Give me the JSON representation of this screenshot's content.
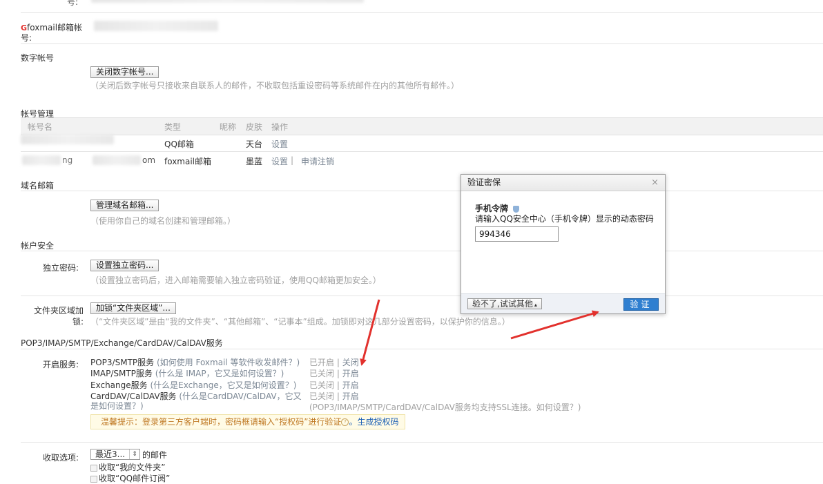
{
  "accounts_top": {
    "top_label_fragment": "号:",
    "foxmail_label": "foxmail邮箱帐号:",
    "foxmail_icon": "foxmail-logo-icon"
  },
  "digital_account": {
    "title": "数字帐号",
    "button": "关闭数字帐号...",
    "note": "（关闭后数字帐号只接收来自联系人的邮件，不收取包括重设密码等系统邮件在内的其他所有邮件。）"
  },
  "account_management": {
    "title": "帐号管理",
    "headers": [
      "帐号名",
      "类型",
      "昵称",
      "皮肤",
      "操作"
    ],
    "rows": [
      {
        "type": "QQ邮箱",
        "skin": "天台",
        "actions": [
          "设置"
        ]
      },
      {
        "name_fragment_a": "ng",
        "name_fragment_b": "om",
        "type": "foxmail邮箱",
        "skin": "墨蓝",
        "actions": [
          "设置",
          "申请注销"
        ],
        "separator": "|"
      }
    ]
  },
  "domain_mail": {
    "title": "域名邮箱",
    "button": "管理域名邮箱...",
    "note": "（使用你自己的域名创建和管理邮箱。）"
  },
  "security": {
    "title": "帐户安全",
    "independent_label": "独立密码:",
    "independent_button": "设置独立密码...",
    "independent_note": "（设置独立密码后，进入邮箱需要输入独立密码验证，使用QQ邮箱更加安全。）",
    "folder_label_1": "文件夹区域加",
    "folder_label_2": "锁:",
    "folder_button": "加锁“文件夹区域”...",
    "folder_note": "（“文件夹区域”是由“我的文件夹”、“其他邮箱”、“记事本”组成。加锁即对这几部分设置密码，以保护你的信息。）"
  },
  "pop3": {
    "title": "POP3/IMAP/SMTP/Exchange/CardDAV/CalDAV服务",
    "label": "开启服务:",
    "services": [
      {
        "name": "POP3/SMTP服务",
        "help": "(如何使用 Foxmail 等软件收发邮件？)",
        "status": "已开启",
        "sep": "|",
        "action": "关闭"
      },
      {
        "name": "IMAP/SMTP服务",
        "help": "(什么是 IMAP，它又是如何设置？)",
        "status": "已关闭",
        "sep": "|",
        "action": "开启"
      },
      {
        "name": "Exchange服务",
        "help": "(什么是Exchange，它又是如何设置？)",
        "status": "已关闭",
        "sep": "|",
        "action": "开启"
      },
      {
        "name": "CardDAV/CalDAV服务",
        "help": "(什么是CardDAV/CalDAV，它又",
        "help2": "是如何设置？)",
        "status": "已关闭",
        "sep": "|",
        "action": "开启"
      }
    ],
    "ssl_note": "(POP3/IMAP/SMTP/CardDAV/CalDAV服务均支持SSL连接。如何设置？)",
    "tip": "温馨提示：登录第三方客户端时，密码框请输入“授权码”进行验证",
    "tip_icon": "help-circle-icon",
    "tip_link": "。生成授权码"
  },
  "receive": {
    "label": "收取选项:",
    "select_value": "最近3...",
    "suffix": "的邮件",
    "options": [
      "收取“我的文件夹”",
      "收取“QQ邮件订阅”"
    ]
  },
  "dialog": {
    "title": "验证密保",
    "close": "×",
    "token_title": "手机令牌",
    "token_icon": "shield-icon",
    "instruction": "请输入QQ安全中心（手机令牌）显示的动态密码",
    "input_value": "994346",
    "other_button": "验不了,试试其他",
    "other_button_arrow": "▴",
    "verify_button": "验证"
  },
  "colors": {
    "arrow_red": "#e2312d",
    "verify_blue": "#2f7fd0",
    "link_blue": "#1c5fb5"
  }
}
